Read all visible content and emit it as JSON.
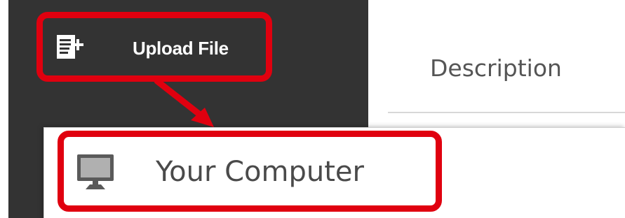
{
  "sidebar": {
    "upload_button": {
      "label": "Upload File",
      "icon": "document-add-icon"
    }
  },
  "details": {
    "description_label": "Description"
  },
  "upload_menu": {
    "items": [
      {
        "label": "Your Computer",
        "icon": "monitor-icon"
      }
    ]
  },
  "annotations": {
    "highlight_color": "#e0000f",
    "arrow": "upload-to-computer-arrow"
  },
  "colors": {
    "sidebar_bg": "#333333",
    "text_light": "#ffffff",
    "text_dark": "#4a4a4a"
  }
}
